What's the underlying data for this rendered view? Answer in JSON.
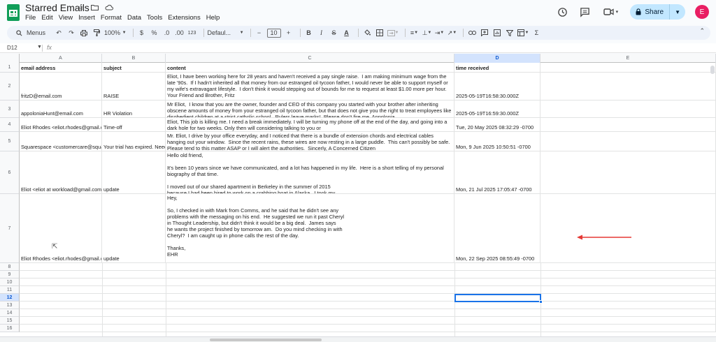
{
  "app": {
    "doc_title": "Starred Emails",
    "menu": [
      "File",
      "Edit",
      "View",
      "Insert",
      "Format",
      "Data",
      "Tools",
      "Extensions",
      "Help"
    ],
    "share_label": "Share",
    "avatar_initial": "E",
    "accent_color": "#1a73e8",
    "share_bg": "#c2e7ff",
    "avatar_color": "#e91e63"
  },
  "toolbar": {
    "menus_label": "Menus",
    "zoom": "100%",
    "currency": "$",
    "percent": "%",
    "dec_decrease": ".0",
    "dec_increase": ".00",
    "number_format": "123",
    "font": "Defaul...",
    "font_size": "10"
  },
  "formula_bar": {
    "name_box": "D12",
    "fx": "fx",
    "value": ""
  },
  "columns": [
    "A",
    "B",
    "C",
    "D",
    "E"
  ],
  "selected_column": "D",
  "rows": [
    "1",
    "2",
    "3",
    "4",
    "5",
    "6",
    "7",
    "8",
    "9",
    "10",
    "11",
    "12",
    "13",
    "14",
    "15",
    "16"
  ],
  "selected_row": "12",
  "headers": {
    "a": "email address",
    "b": "subject",
    "c": "content",
    "d": "time received"
  },
  "records": [
    {
      "email": "fritzD@email.com",
      "subject": "RAISE",
      "content": "Eliot, I have been working here for 28 years and haven't received a pay single raise.  I am making minimum wage from the late '90s.  If I hadn't inherited all that money from our estranged oil tycoon father, I would never be able to support myself or my wife's extravagant lifestyle.  I don't think it would stepping out of bounds for me to request at least $1.00 more per hour. Your Friend and Brother, Fritz",
      "time": "2025-05-19T16:58:30.000Z"
    },
    {
      "email": "appoloniaHunt@email.com",
      "subject": "HR Violation",
      "content": "Mr Eliot,  I know that you are the owner, founder and CEO of this company you started with your brother after inheriting obscene amounts of money from your estranged oil tycoon father, but that does not give you the right to treat employees like disobedient children at a strict catholic school.  Rulers leave marks!  Please don't fire me, Appolonia",
      "time": "2025-05-19T16:59:30.000Z"
    },
    {
      "email": "Eliot Rhodes <eliot.rhodes@gmail.c",
      "subject": "Time-off",
      "content": "Eliot, This job is killing me. I need a break immediately. I will be turning my phone off at the end of the day, and going into a dark hole for two weeks. Only then will considering talking to you or",
      "time": "Tue, 20 May 2025 08:32:29 -0700"
    },
    {
      "email": "Squarespace <customercare@squa",
      "subject": "Your trial has expired. Neec",
      "content": "Mr. Eliot, I drive by your office everyday, and I noticed that there is a bundle of extension chords and electrical cables hanging out your window.  Since the recent rains, these wires are now resting in a large puddle.  This can't possibly be safe.  Please tend to this matter ASAP or I will alert the authorities.  Sincerly, A Concerned Citizen",
      "time": "Mon, 9 Jun 2025 10:50:51 -0700"
    },
    {
      "email": "Eliot <eliot at workload@gmail.com>",
      "subject": "update",
      "content": "Hello old friend,\n\nIt's been 10 years since we have communicated, and a lot has happened in my life.  Here is a short telling of my personal biography of that time.\n\nI moved out of our shared apartment in Berkeley in the summer of 2015\nbecause I had been hired to work on a crabbing boat in Alaska.  I took my",
      "time": "Mon, 21 Jul 2025 17:05:47 -0700"
    },
    {
      "email": "Eliot Rhodes <eliot.rhodes@gmail.c",
      "subject": "update",
      "content": "Hey,\n\nSo, I checked in with Mark from Comms, and he said that he didn't see any\nproblems with the messaging on his end.  He suggested we run it past Cheryl\nin Thought Leadership, but didn't think it would be a big deal.  James says\nhe wants the project finished by tomorrow am.  Do you mind checking in with\nCheryl?  I am caught up in phone calls the rest of the day.\n\nThanks,\nEHR",
      "time": "Mon, 22 Sep 2025 08:55:49 -0700"
    }
  ]
}
